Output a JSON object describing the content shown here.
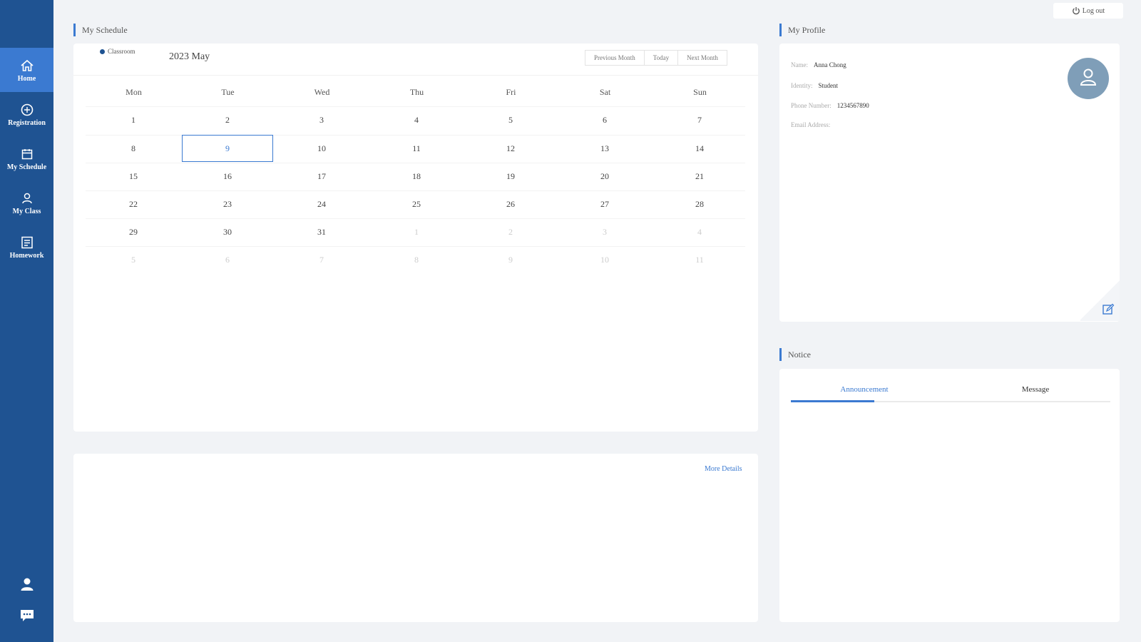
{
  "sidebar": {
    "items": [
      {
        "label": "Home",
        "icon": "home-icon"
      },
      {
        "label": "Registration",
        "icon": "registration-icon"
      },
      {
        "label": "My Schedule",
        "icon": "calendar-icon"
      },
      {
        "label": "My Class",
        "icon": "class-icon"
      },
      {
        "label": "Homework",
        "icon": "homework-icon"
      }
    ],
    "bottom_icons": [
      "user-icon",
      "message-icon"
    ],
    "active_index": 0,
    "color": "#1f5392",
    "active_color": "#3b7ad1"
  },
  "header": {
    "logout_label": "Log out"
  },
  "schedule": {
    "section_title": "My Schedule",
    "legend_label": "Classroom",
    "month_title": "2023 May",
    "buttons": [
      "Previous Month",
      "Today",
      "Next Month"
    ],
    "weekdays": [
      "Mon",
      "Tue",
      "Wed",
      "Thu",
      "Fri",
      "Sat",
      "Sun"
    ],
    "weeks": [
      [
        "1",
        "2",
        "3",
        "4",
        "5",
        "6",
        "7"
      ],
      [
        "8",
        "9",
        "10",
        "11",
        "12",
        "13",
        "14"
      ],
      [
        "15",
        "16",
        "17",
        "18",
        "19",
        "20",
        "21"
      ],
      [
        "22",
        "23",
        "24",
        "25",
        "26",
        "27",
        "28"
      ],
      [
        "29",
        "30",
        "31",
        "1",
        "2",
        "3",
        "4"
      ],
      [
        "5",
        "6",
        "7",
        "8",
        "9",
        "10",
        "11"
      ]
    ],
    "selected_day": "9",
    "more_details": "More Details"
  },
  "profile": {
    "section_title": "My Profile",
    "fields": [
      {
        "label": "Name:",
        "value": "Anna Chong"
      },
      {
        "label": "Identity:",
        "value": "Student"
      },
      {
        "label": "Phone Number:",
        "value": "1234567890"
      },
      {
        "label": "Email Address:",
        "value": ""
      }
    ]
  },
  "notice": {
    "section_title": "Notice",
    "tabs": [
      "Announcement",
      "Message"
    ],
    "active_tab": 0
  }
}
